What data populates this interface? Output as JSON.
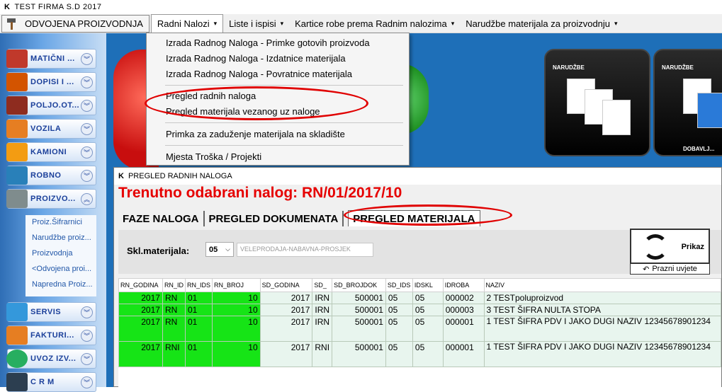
{
  "window": {
    "title": "TEST FIRMA  S.D  2017"
  },
  "menubar": {
    "items": [
      {
        "label": "ODVOJENA PROIZVODNJA"
      },
      {
        "label": "Radni Nalozi",
        "arrow": "▾"
      },
      {
        "label": "Liste i ispisi",
        "arrow": "▾"
      },
      {
        "label": "Kartice robe prema Radnim nalozima",
        "arrow": "▾"
      },
      {
        "label": "Narudžbe materijala za proizvodnju",
        "arrow": "▾"
      }
    ]
  },
  "dropdown": {
    "items": [
      {
        "label": "Izrada Radnog Naloga - Primke gotovih proizvoda"
      },
      {
        "label": "Izrada Radnog Naloga - Izdatnice materijala"
      },
      {
        "label": "Izrada Radnog Naloga - Povratnice materijala"
      },
      {
        "label": "Pregled radnih naloga"
      },
      {
        "label": "Pregled materijala vezanog uz naloge"
      },
      {
        "label": "Primka za zaduženje materijala na skladište"
      },
      {
        "label": "Mjesta Troška / Projekti"
      }
    ]
  },
  "sidebar": {
    "items": [
      {
        "label": "MATIČNI ...",
        "icon": "books-icon",
        "color": "#c0392b"
      },
      {
        "label": "DOPISI I ...",
        "icon": "letter-icon",
        "color": "#d35400"
      },
      {
        "label": "POLJO.OT...",
        "icon": "tractor-icon",
        "color": "#8e2c1f"
      },
      {
        "label": "VOZILA",
        "icon": "car-icon",
        "color": "#e67e22"
      },
      {
        "label": "KAMIONI",
        "icon": "truck-icon",
        "color": "#f39c12"
      },
      {
        "label": "ROBNO",
        "icon": "book-icon",
        "color": "#2980b9"
      },
      {
        "label": "PROIZVO...",
        "icon": "hammer-icon",
        "color": "#7f8c8d"
      },
      {
        "label": "SERVIS",
        "icon": "tools-icon",
        "color": "#3498db"
      },
      {
        "label": "FAKTURI...",
        "icon": "invoice-icon",
        "color": "#e67e22"
      },
      {
        "label": "UVOZ IZV...",
        "icon": "globe-icon",
        "color": "#27ae60"
      },
      {
        "label": "C R M",
        "icon": "people-icon",
        "color": "#2c3e50"
      }
    ],
    "subitems": [
      {
        "label": "Proiz.Šifrarnici"
      },
      {
        "label": "Narudžbe proiz..."
      },
      {
        "label": "Proizvodnja"
      },
      {
        "label": "<Odvojena proi..."
      },
      {
        "label": "Napredna Proiz..."
      }
    ]
  },
  "desktop": {
    "tiles": [
      {
        "label": "NARUDŽBE"
      },
      {
        "label": "NARUDŽBE",
        "sublabel": "DOBAVLJ..."
      }
    ]
  },
  "pregled": {
    "title": "PREGLED RADNIH NALOGA",
    "current_label": "Trenutno odabrani nalog: RN/01/2017/10",
    "tabs": [
      {
        "label": "FAZE NALOGA"
      },
      {
        "label": "PREGLED DOKUMENATA"
      },
      {
        "label": "PREGLED MATERIJALA"
      }
    ],
    "filter": {
      "label": "Skl.materijala:",
      "value": "05",
      "description": "VELEPRODAJA-NABAVNA-PROSJEK",
      "show_button": "Prikaz",
      "clear_button": "Prazni uvjete"
    },
    "columns": [
      "RN_GODINA",
      "RN_ID",
      "RN_IDS",
      "RN_BROJ",
      "SD_GODINA",
      "SD_",
      "SD_BROJDOK",
      "SD_IDS",
      "IDSKL",
      "IDROBA",
      "NAZIV"
    ],
    "rows": [
      [
        "2017",
        "RN",
        "01",
        "10",
        "2017",
        "IRN",
        "500001",
        "05",
        "05",
        "000002",
        "2 TESTpoluproizvod"
      ],
      [
        "2017",
        "RN",
        "01",
        "10",
        "2017",
        "IRN",
        "500001",
        "05",
        "05",
        "000003",
        "3 TEST ŠIFRA NULTA STOPA"
      ],
      [
        "2017",
        "RN",
        "01",
        "10",
        "2017",
        "IRN",
        "500001",
        "05",
        "05",
        "000001",
        "1 TEST ŠIFRA PDV I JAKO DUGI NAZIV 12345678901234"
      ],
      [
        "2017",
        "RNI",
        "01",
        "10",
        "2017",
        "RNI",
        "500001",
        "05",
        "05",
        "000001",
        "1 TEST ŠIFRA PDV I JAKO DUGI NAZIV 12345678901234"
      ]
    ]
  },
  "colors": {
    "highlight": "#e60000",
    "green_cell": "#16e416",
    "row_bg": "#e8f5ee"
  }
}
